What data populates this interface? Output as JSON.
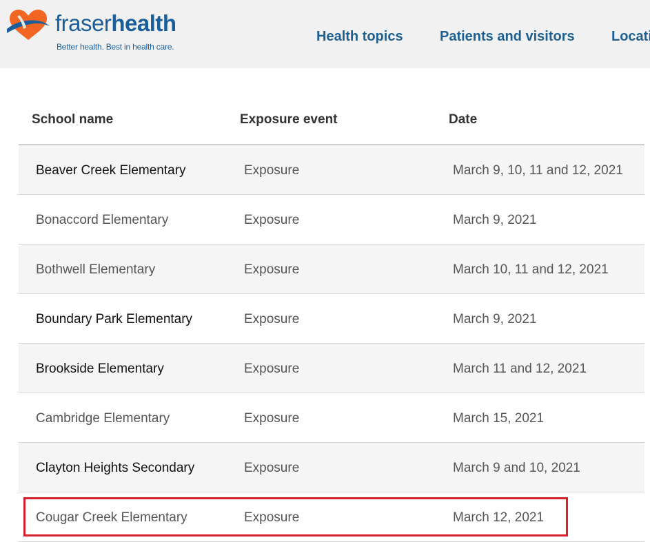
{
  "header": {
    "brand_part1": "fraser",
    "brand_part2": "health",
    "tagline": "Better health. Best in health care.",
    "nav": [
      "Health topics",
      "Patients and visitors",
      "Locati"
    ]
  },
  "table": {
    "columns": [
      "School name",
      "Exposure event",
      "Date"
    ],
    "rows": [
      {
        "school": "Beaver Creek Elementary",
        "event": "Exposure",
        "date": "March 9, 10, 11 and 12, 2021"
      },
      {
        "school": "Bonaccord Elementary",
        "event": "Exposure",
        "date": "March 9, 2021"
      },
      {
        "school": "Bothwell Elementary",
        "event": "Exposure",
        "date": "March 10, 11 and 12, 2021"
      },
      {
        "school": "Boundary Park Elementary",
        "event": "Exposure",
        "date": "March 9, 2021"
      },
      {
        "school": "Brookside Elementary",
        "event": "Exposure",
        "date": "March 11 and 12, 2021"
      },
      {
        "school": "Cambridge Elementary",
        "event": "Exposure",
        "date": "March 15, 2021"
      },
      {
        "school": "Clayton Heights Secondary",
        "event": "Exposure",
        "date": "March 9 and 10, 2021"
      },
      {
        "school": "Cougar Creek Elementary",
        "event": "Exposure",
        "date": "March 12, 2021"
      }
    ]
  },
  "colors": {
    "brand_blue": "#1a5f9b",
    "logo_orange": "#f26522",
    "highlight_red": "#d81e2a"
  }
}
